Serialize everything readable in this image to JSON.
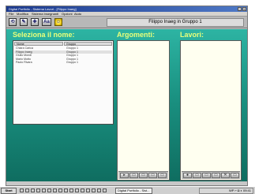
{
  "window": {
    "title": "Digital Portfolio - Sistema Lavori - [Filippo Inaeg]"
  },
  "menubar": {
    "items": [
      "File",
      "Modifica",
      "Sistema Insegnanti",
      "Opzioni",
      "Aiuto"
    ]
  },
  "toolbar": {
    "buttons": [
      {
        "name": "back-button",
        "icon": "back-arrow-icon",
        "glyph": "⟲"
      },
      {
        "name": "edit-button",
        "icon": "pencil-icon",
        "glyph": "✎"
      },
      {
        "name": "cross-button",
        "icon": "cross-icon",
        "glyph": "✚"
      },
      {
        "name": "text-size-button",
        "icon": "text-size-icon",
        "glyph": "Aa"
      },
      {
        "name": "smiley-button",
        "icon": "smiley-icon",
        "glyph": "☺"
      }
    ],
    "current_student": "Filippo Inaeg in Gruppo 1"
  },
  "sections": {
    "select_name": "Seleziona il nome:",
    "arguments": "Argomenti:",
    "works": "Lavori:"
  },
  "student_list": {
    "headers": [
      "Nome",
      "Gruppo"
    ],
    "rows": [
      {
        "name": "Chiara Carica",
        "group": "Gruppo 1",
        "selected": false
      },
      {
        "name": "Filippo Inaeg",
        "group": "Gruppo 1",
        "selected": true
      },
      {
        "name": "Giulio Mondi",
        "group": "Gruppo 1",
        "selected": false
      },
      {
        "name": "Mario Motto",
        "group": "Gruppo 1",
        "selected": false
      },
      {
        "name": "Paolo Rivara",
        "group": "Gruppo 1",
        "selected": false
      }
    ]
  },
  "taskbar": {
    "start_label": "Start",
    "active_task": "Digital Portfolio - Sist...",
    "tray": "WP  ⌐  ◘  ◐  09:41"
  },
  "colors": {
    "teal": "#1a9181",
    "heading": "#e8ff7a"
  }
}
